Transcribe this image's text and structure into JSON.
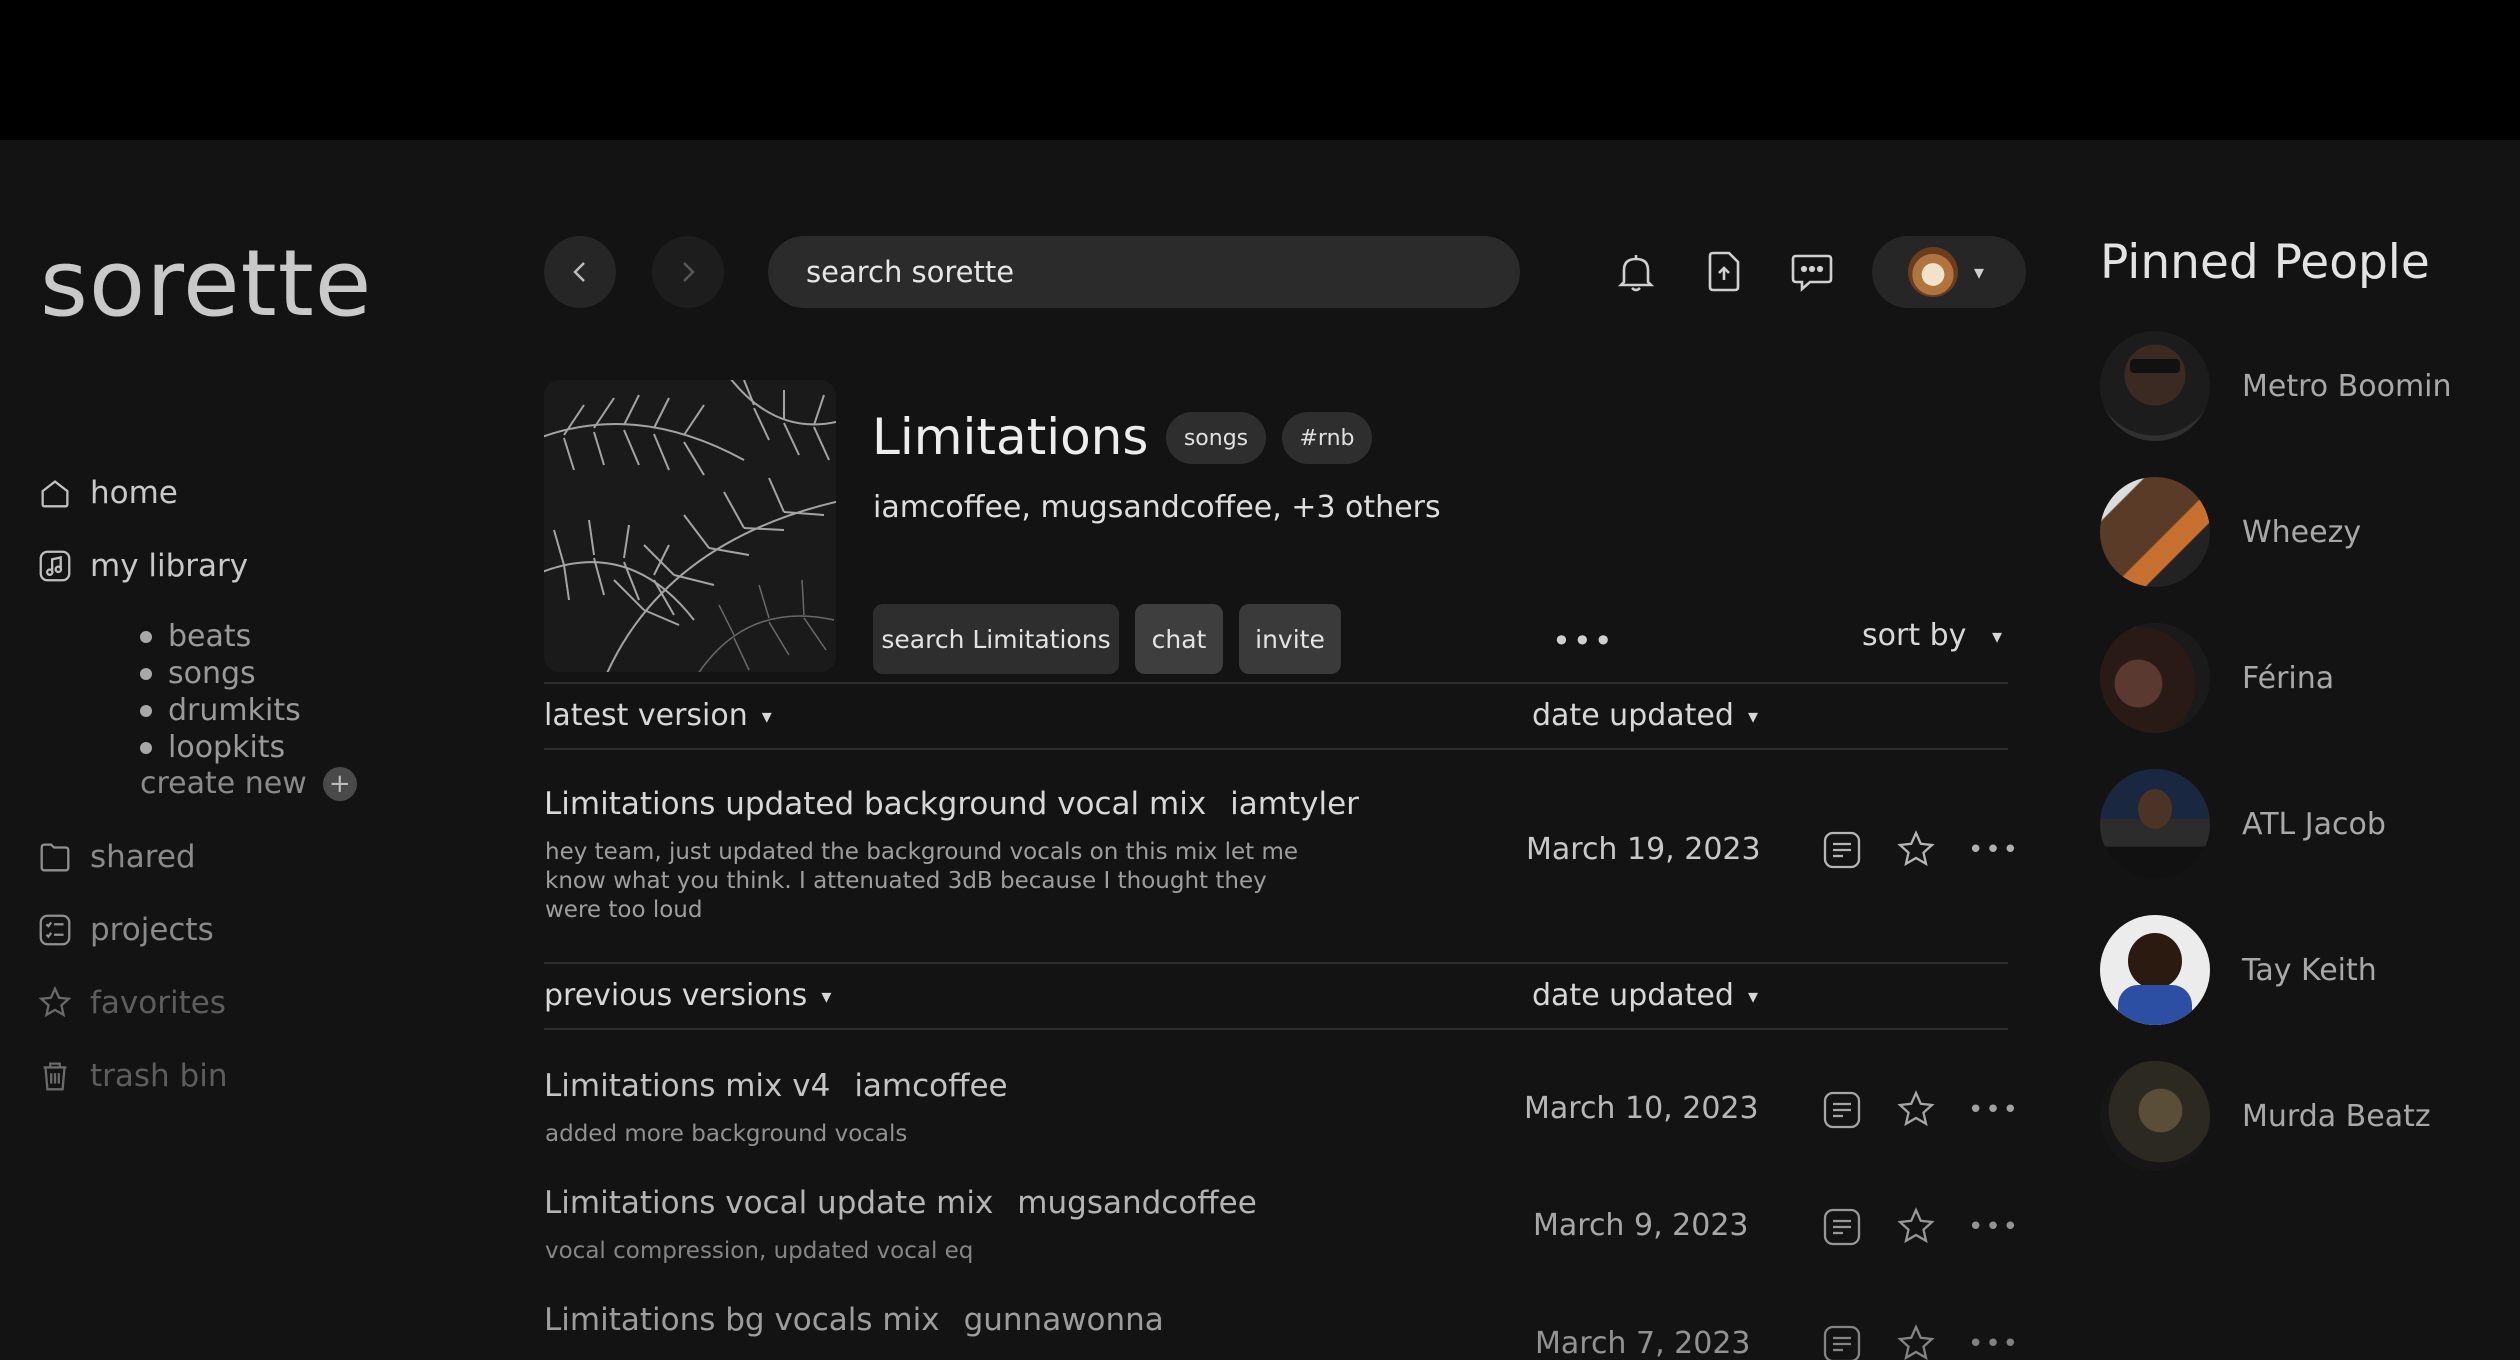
{
  "app": {
    "logo": "sorette"
  },
  "sidebar": {
    "items": [
      {
        "label": "home",
        "icon": "home-icon"
      },
      {
        "label": "my library",
        "icon": "music-note-icon"
      },
      {
        "label": "shared",
        "icon": "folder-icon"
      },
      {
        "label": "projects",
        "icon": "checklist-icon"
      },
      {
        "label": "favorites",
        "icon": "star-icon"
      },
      {
        "label": "trash bin",
        "icon": "trash-icon"
      }
    ],
    "library_sub": [
      "beats",
      "songs",
      "drumkits",
      "loopkits"
    ],
    "create_new": "create new",
    "create_plus": "+"
  },
  "topbar": {
    "search_placeholder": "search sorette",
    "back_icon": "chevron-left-icon",
    "forward_icon": "chevron-right-icon",
    "notification_icon": "bell-icon",
    "upload_icon": "upload-icon",
    "messages_icon": "chat-bubble-icon",
    "profile_caret": "▾"
  },
  "project": {
    "title": "Limitations",
    "tags": [
      "songs",
      "#rnb"
    ],
    "collaborators": "iamcoffee, mugsandcoffee, +3 others",
    "actions": [
      "search Limitations",
      "chat",
      "invite"
    ],
    "more": "•••",
    "sort_by": "sort by",
    "sort_caret": "▾"
  },
  "latest": {
    "label": "latest version",
    "sort_label": "date updated",
    "caret": "▾",
    "item": {
      "title": "Limitations updated background vocal mix",
      "author": "iamtyler",
      "description": "hey team, just updated the background vocals on this mix let me know what you think. I attenuated 3dB because I thought they were too loud",
      "date": "March 19, 2023"
    }
  },
  "previous": {
    "label": "previous versions",
    "sort_label": "date updated",
    "caret": "▾",
    "items": [
      {
        "title": "Limitations mix v4",
        "author": "iamcoffee",
        "description": "added more background vocals",
        "date": "March 10, 2023"
      },
      {
        "title": "Limitations vocal update mix",
        "author": "mugsandcoffee",
        "description": "vocal compression, updated vocal eq",
        "date": "March 9, 2023"
      },
      {
        "title": "Limitations bg vocals mix",
        "author": "gunnawonna",
        "description": "",
        "date": "March 7, 2023"
      }
    ]
  },
  "row_more": "•••",
  "pinned": {
    "title": "Pinned People",
    "people": [
      {
        "name": "Metro Boomin"
      },
      {
        "name": "Wheezy"
      },
      {
        "name": "Férina"
      },
      {
        "name": "ATL Jacob"
      },
      {
        "name": "Tay Keith"
      },
      {
        "name": "Murda Beatz"
      }
    ]
  },
  "colors": {
    "background": "#131313",
    "surface": "#2b2b2b",
    "text": "#d8d8d8",
    "muted": "#8a8a8a"
  }
}
